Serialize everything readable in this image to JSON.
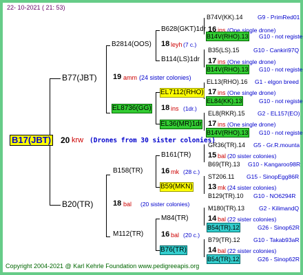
{
  "header": {
    "date": "22- 10-2021 ( 21: 53)"
  },
  "footer": {
    "copyright": "Copyright 2004-2021 @ Karl Kehrle Foundation    www.pedigreeapis.org"
  },
  "root": {
    "name": "B17(JBT)",
    "num": "20",
    "label": "krw",
    "note": "(Drones from 30 sister colonies)"
  },
  "g1": [
    {
      "name": "B77(JBT)",
      "num": "19",
      "label": "amm",
      "note": "(24 sister colonies)"
    },
    {
      "name": "B20(TR)",
      "num": "18",
      "label": "bal",
      "note": "(20 sister colonies)"
    }
  ],
  "g2": [
    {
      "name": "B2814(OOS)",
      "num": "18",
      "label": "leyh",
      "note": "(7 c.)"
    },
    {
      "name": "EL8736(GG)",
      "num": "18",
      "label": "ins",
      "note": "(1dr.)"
    },
    {
      "name": "B158(TR)",
      "num": "16",
      "label": "mk",
      "note": "(28 c.)"
    },
    {
      "name": "M112(TR)",
      "num": "16",
      "label": "bal",
      "note": "(20 c.)"
    }
  ],
  "g3": [
    {
      "name": "B628(GKT)1dr",
      "num": "16",
      "label": "ins",
      "note": "(One single drone)"
    },
    {
      "name": "B114(LS)1dr",
      "num": "17",
      "label": "ins",
      "note": "(One single drone)"
    },
    {
      "name": "EL7112(RHO)",
      "num": "17",
      "label": "ins",
      "note": "(One single drone)"
    },
    {
      "name": "EL36(MR)1dr",
      "num": "17",
      "label": "ins",
      "note": "(One single drone)"
    },
    {
      "name": "B161(TR)",
      "num": "15",
      "label": "bal",
      "note": "(20 sister colonies)"
    },
    {
      "name": "B59(MKN)",
      "num": "13",
      "label": "mk",
      "note": "(24 sister colonies)"
    },
    {
      "name": "M84(TR)",
      "num": "14",
      "label": "bal",
      "note": "(22 sister colonies)"
    },
    {
      "name": "B76(TR)",
      "num": "14",
      "label": "bal",
      "note": "(22 sister colonies)"
    }
  ],
  "g4": [
    {
      "name": "B74V(KK).14",
      "info": "G9 - PrimRed01"
    },
    {
      "name": "B14V(RHO).13",
      "info": "G10 - not registe"
    },
    {
      "name": "B35(LS).15",
      "info": "G10 - Cankiri97Q"
    },
    {
      "name": "B14V(RHO).13",
      "info": "G10 - not registe"
    },
    {
      "name": "EL13(RHO).16",
      "info": "G1 - elgon breed"
    },
    {
      "name": "EL84(KK).13",
      "info": "G10 - not registe"
    },
    {
      "name": "EL8(RKR).15",
      "info": "G2 - EL157(EO)"
    },
    {
      "name": "B14V(RHO).13",
      "info": "G10 - not registe"
    },
    {
      "name": "GR36(TR).14",
      "info": "G5 - Gr.R.mounta"
    },
    {
      "name": "B69(TR).13",
      "info": "G10 - Kangaroo98R"
    },
    {
      "name": "ST206.11",
      "info": "G15 - SinopEgg86R"
    },
    {
      "name": "B129(TR).10",
      "info": "G10 - NO6294R"
    },
    {
      "name": "M180(TR).13",
      "info": "G2 - KilimandQ"
    },
    {
      "name": "B54(TR).12",
      "info": "G26 - Sinop62R"
    },
    {
      "name": "B79(TR).12",
      "info": "G10 - Takab93aR"
    },
    {
      "name": "B54(TR).12",
      "info": "G26 - Sinop62R"
    }
  ]
}
